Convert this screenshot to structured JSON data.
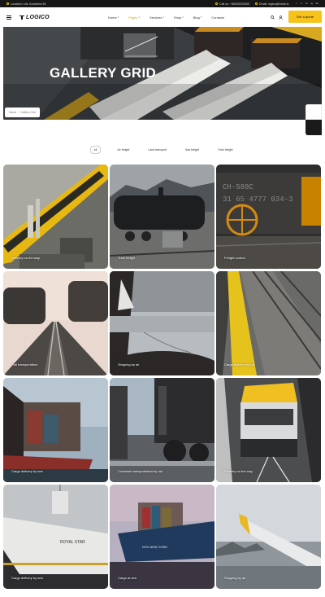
{
  "topbar": {
    "location": "Location: Lek. Autobahn 45",
    "phone": "Call us: +46200203400",
    "email": "Email: logico@email.io",
    "socials": [
      "f",
      "x",
      "in",
      "ig",
      "be"
    ]
  },
  "header": {
    "logo": "LOGICO",
    "nav": [
      "Home",
      "Pages",
      "Services",
      "Shop",
      "Blog",
      "Contacts"
    ],
    "active_nav": "Pages",
    "cta": "Get a quote"
  },
  "hero": {
    "title": "GALLERY GRID",
    "breadcrumb_home": "Home",
    "breadcrumb_sep": "/",
    "breadcrumb_current": "Gallery Grid"
  },
  "filters": [
    "All",
    "Air freight",
    "Land transport",
    "Sea freight",
    "Train freight"
  ],
  "active_filter": "All",
  "gallery": [
    {
      "caption": "Delivery on the way"
    },
    {
      "caption": "Train freight"
    },
    {
      "caption": "Freight control"
    },
    {
      "caption": "Rail transportation"
    },
    {
      "caption": "Shipping by air"
    },
    {
      "caption": "Cargo delivery by rail"
    },
    {
      "caption": "Cargo delivery by sea"
    },
    {
      "caption": "Container transportation by rail"
    },
    {
      "caption": "Delivery on the way"
    },
    {
      "caption": "Cargo delivery by sea"
    },
    {
      "caption": "Cargo at sea"
    },
    {
      "caption": "Shipping by air"
    }
  ],
  "colors": {
    "accent": "#f7c21a",
    "dark": "#161616"
  }
}
